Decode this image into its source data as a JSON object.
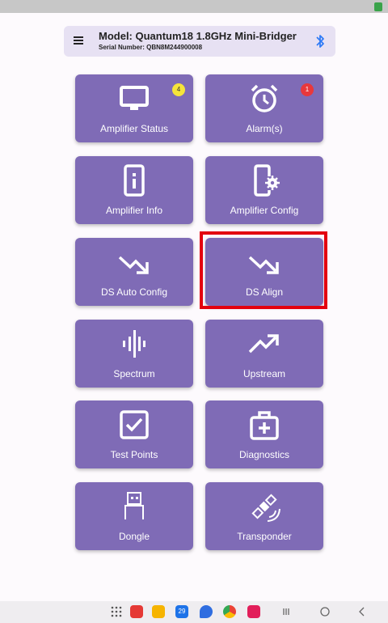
{
  "header": {
    "title": "Model: Quantum18 1.8GHz Mini-Bridger",
    "serial": "Serial Number: QBN8M244900008"
  },
  "tiles": [
    {
      "label": "Amplifier Status",
      "icon": "monitor-icon",
      "badge": "4",
      "badge_color": "#f6e43a"
    },
    {
      "label": "Alarm(s)",
      "icon": "alarm-clock-icon",
      "badge": "1",
      "badge_color": "#e8383b"
    },
    {
      "label": "Amplifier Info",
      "icon": "info-device-icon"
    },
    {
      "label": "Amplifier Config",
      "icon": "device-settings-icon"
    },
    {
      "label": "DS Auto Config",
      "icon": "trending-down-icon"
    },
    {
      "label": "DS Align",
      "icon": "trending-down-icon"
    },
    {
      "label": "Spectrum",
      "icon": "waveform-icon"
    },
    {
      "label": "Upstream",
      "icon": "trending-up-icon"
    },
    {
      "label": "Test Points",
      "icon": "checkbox-icon"
    },
    {
      "label": "Diagnostics",
      "icon": "first-aid-kit-icon"
    },
    {
      "label": "Dongle",
      "icon": "usb-dongle-icon"
    },
    {
      "label": "Transponder",
      "icon": "satellite-icon"
    }
  ],
  "taskbar": {
    "calendar_day": "29"
  },
  "colors": {
    "tile": "#7f6bb6",
    "header_bg": "#e7e1f3",
    "highlight": "#e3000f",
    "bluetooth": "#2f7bf6"
  }
}
